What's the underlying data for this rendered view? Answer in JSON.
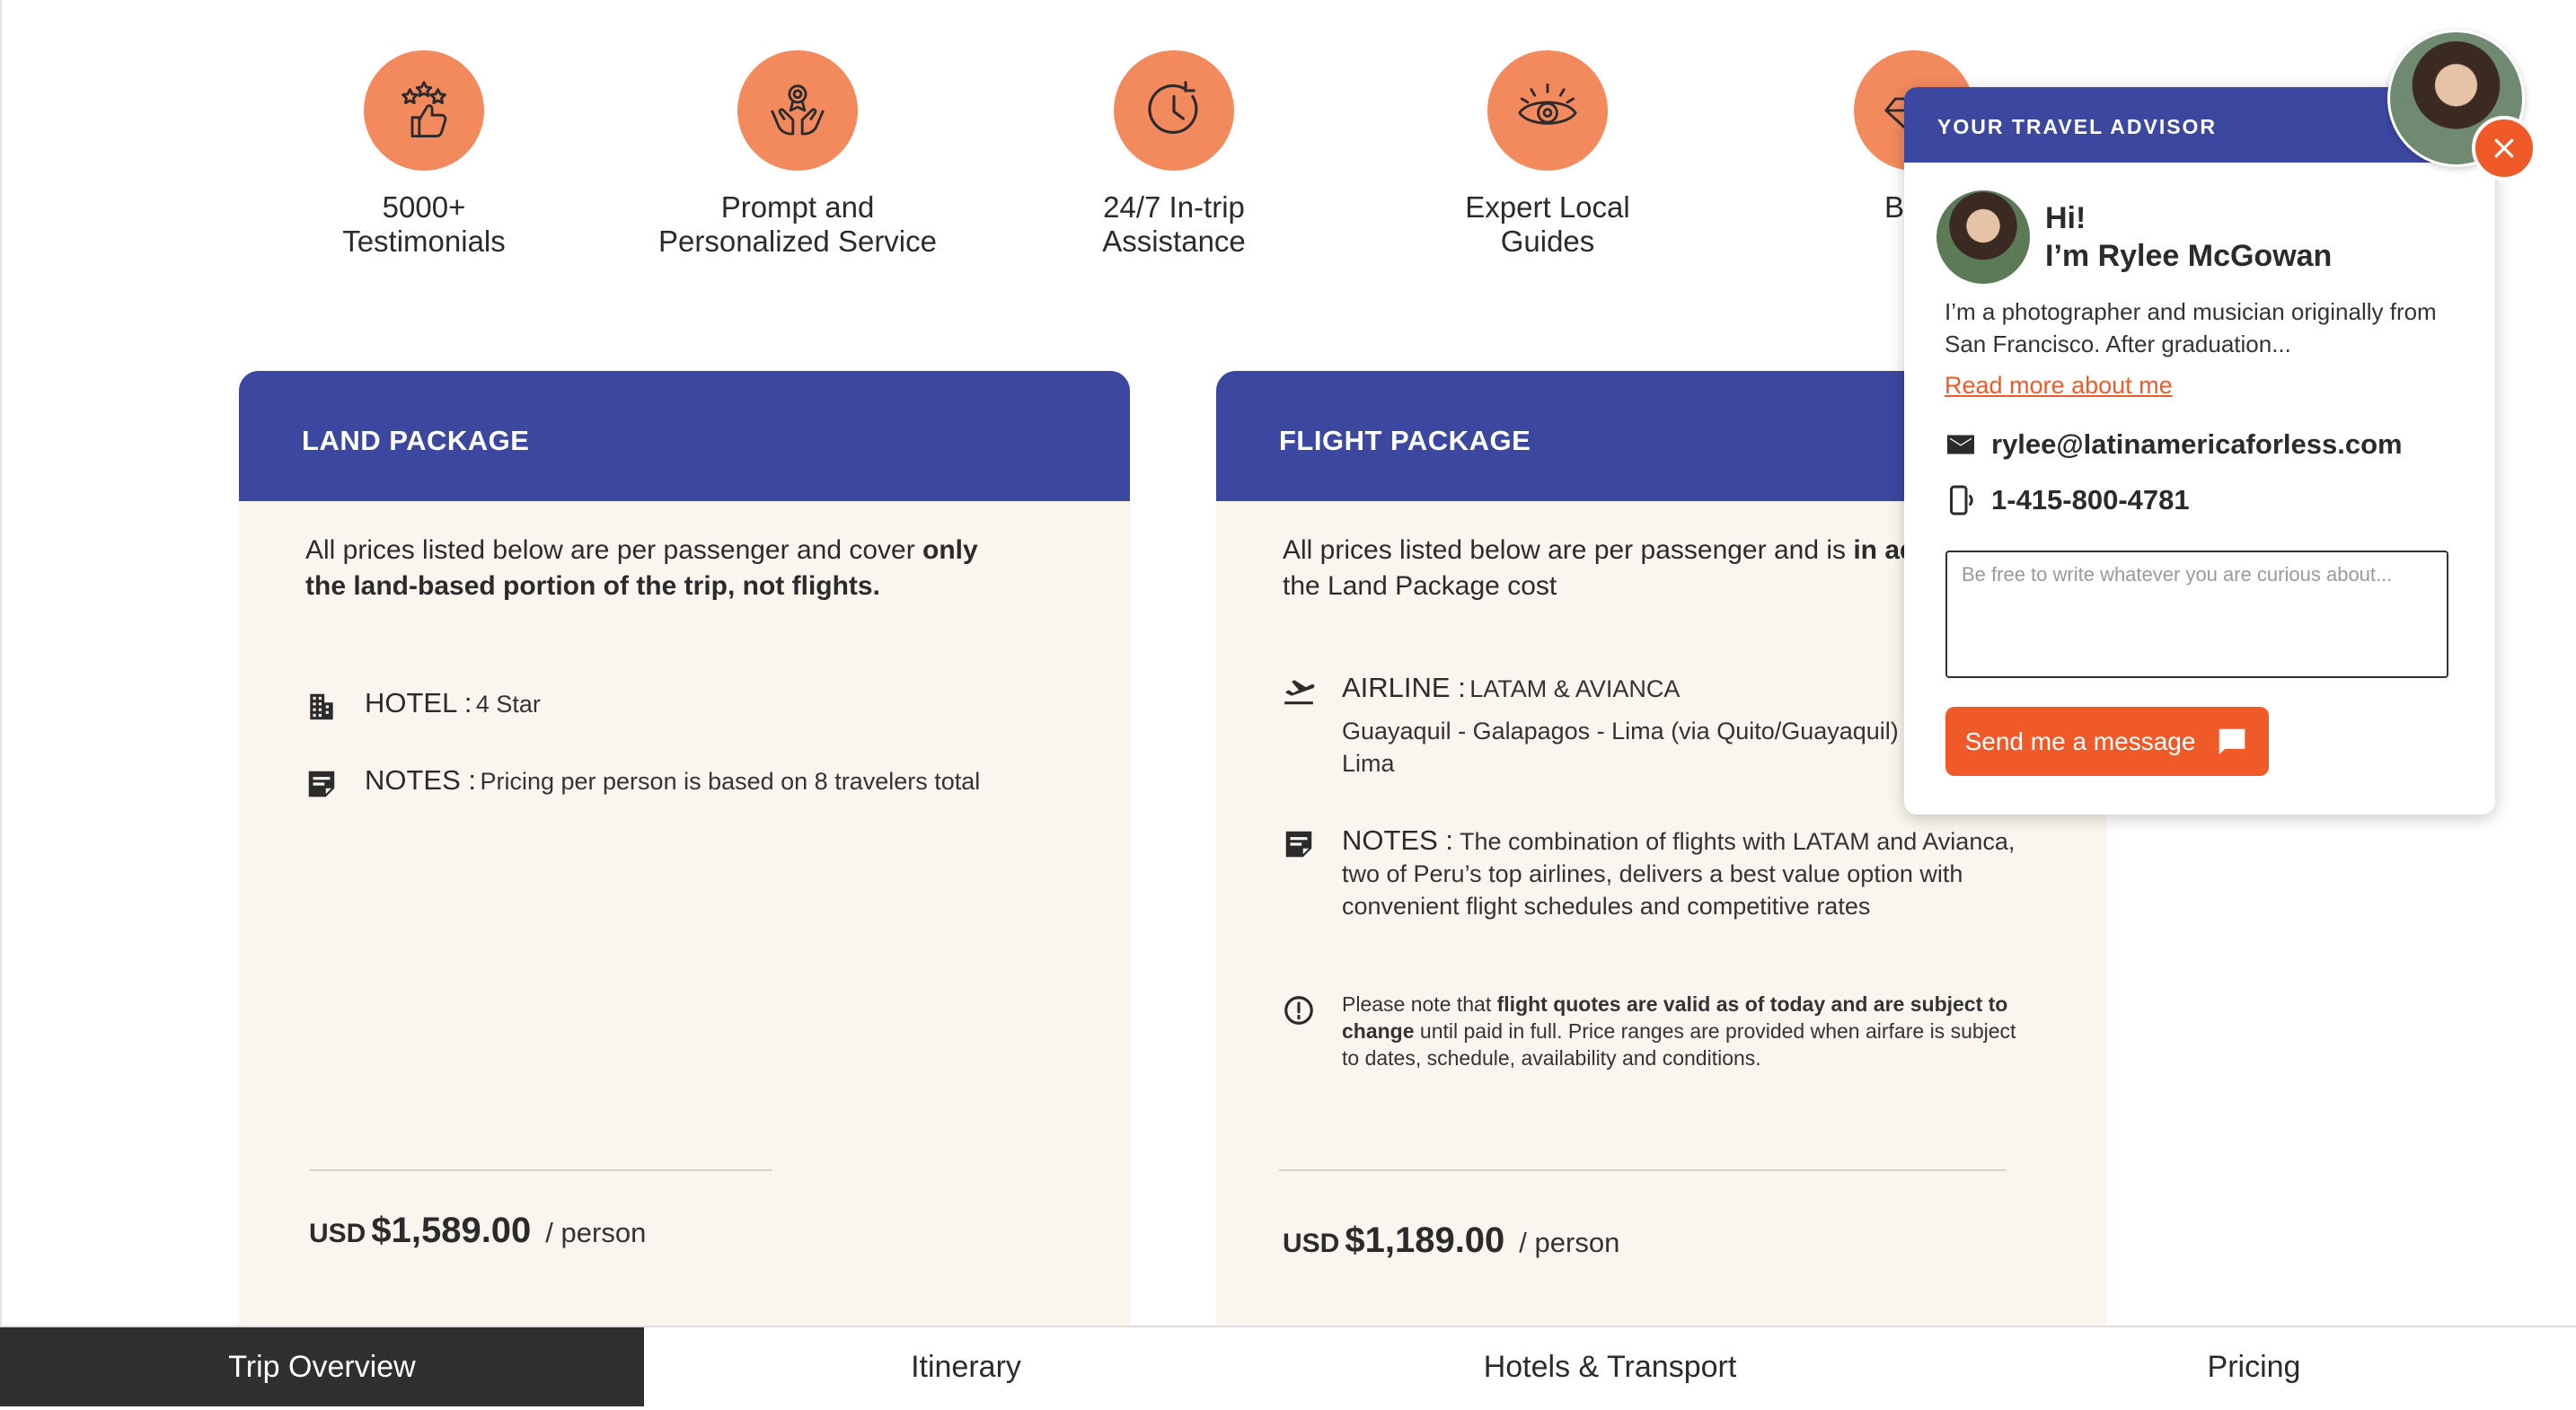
{
  "features": [
    {
      "icon": "thumbs-up-stars-icon",
      "line1": "5000+",
      "line2": "Testimonials"
    },
    {
      "icon": "hands-award-icon",
      "line1": "Prompt and",
      "line2": "Personalized Service"
    },
    {
      "icon": "clock-cycle-icon",
      "line1": "24/7 In-trip",
      "line2": "Assistance"
    },
    {
      "icon": "eye-icon",
      "line1": "Expert Local",
      "line2": "Guides"
    },
    {
      "icon": "diamond-icon",
      "line1": "Best",
      "line2": ""
    }
  ],
  "land_package": {
    "title": "LAND PACKAGE",
    "intro_plain": "All prices listed below are per passenger and cover ",
    "intro_bold": "only the land-based portion of the trip, not flights.",
    "hotel_label": "HOTEL :",
    "hotel_value": "4 Star",
    "notes_label": "NOTES :",
    "notes_value": "Pricing per person is based on 8 travelers total",
    "currency": "USD",
    "amount": "$1,589.00",
    "per": "/ person"
  },
  "flight_package": {
    "title": "FLIGHT PACKAGE",
    "intro_plain": "All prices listed below are per passenger and is ",
    "intro_bold": "in ad",
    "intro_line2": "the Land Package cost",
    "airline_label": "AIRLINE :",
    "airline_value": "LATAM & AVIANCA",
    "route": "Guayaquil - Galapagos - Lima (via Quito/Guayaquil) - Lima",
    "notes_label": "NOTES :",
    "notes_value": "The combination of flights with LATAM and Avianca, two of Peru’s top airlines, delivers a best value option with convenient flight schedules and competitive rates",
    "disclaimer_prefix": "Please note that ",
    "disclaimer_bold": "flight quotes are valid as of today and are subject to change",
    "disclaimer_rest": " until paid in full. Price ranges are provided when airfare is subject to dates, schedule, availability and conditions.",
    "currency": "USD",
    "amount": "$1,189.00",
    "per": "/ person"
  },
  "advisor": {
    "header": "YOUR TRAVEL ADVISOR",
    "greeting": "Hi!",
    "name": "I’m Rylee McGowan",
    "bio": "I’m a photographer and musician originally from San Francisco. After graduation...",
    "read_more": "Read more about me",
    "email": "rylee@latinamericaforless.com",
    "phone": "1-415-800-4781",
    "message_placeholder": "Be free to write whatever you are curious about...",
    "send_label": "Send me a message"
  },
  "tabs": [
    {
      "label": "Trip Overview",
      "active": true
    },
    {
      "label": "Itinerary",
      "active": false
    },
    {
      "label": "Hotels & Transport",
      "active": false
    },
    {
      "label": "Pricing",
      "active": false
    }
  ],
  "colors": {
    "accent_orange": "#f38a5e",
    "button_orange": "#ef5a28",
    "header_blue": "#3c47a0",
    "card_bg": "#faf6ef",
    "active_tab": "#2f2f2f"
  }
}
